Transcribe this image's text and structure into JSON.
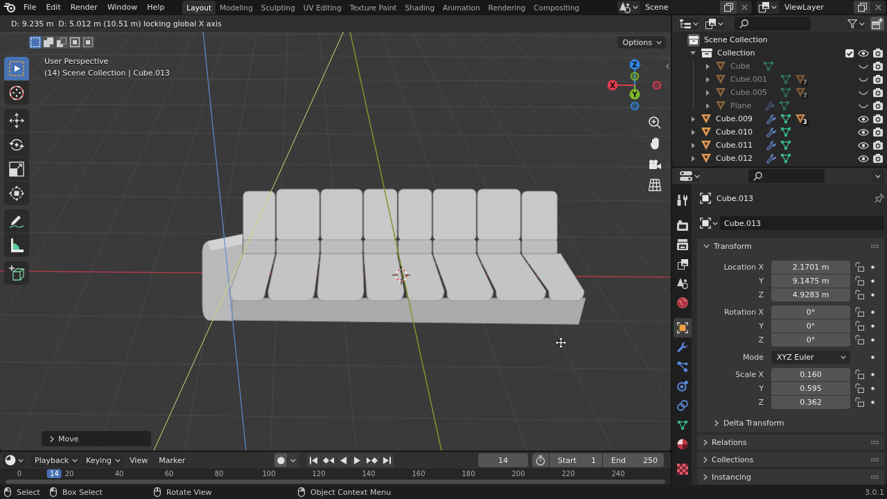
{
  "top_bar": {
    "menus": [
      "File",
      "Edit",
      "Render",
      "Window",
      "Help"
    ],
    "workspaces": [
      {
        "label": "Layout",
        "selected": true
      },
      {
        "label": "Modeling",
        "selected": false
      },
      {
        "label": "Sculpting",
        "selected": false
      },
      {
        "label": "UV Editing",
        "selected": false
      },
      {
        "label": "Texture Paint",
        "selected": false
      },
      {
        "label": "Shading",
        "selected": false
      },
      {
        "label": "Animation",
        "selected": false
      },
      {
        "label": "Rendering",
        "selected": false
      },
      {
        "label": "Compositing",
        "selected": false
      }
    ],
    "scene": "Scene",
    "view_layer": "ViewLayer"
  },
  "viewport": {
    "status_text": "D: 9.235 m  D: 5.012 m (10.51 m) locking global X axis",
    "select_modes": [
      {
        "kind": "set",
        "selected": true
      },
      {
        "kind": "extend",
        "selected": false
      },
      {
        "kind": "subtract",
        "selected": false
      },
      {
        "kind": "invert",
        "selected": false
      },
      {
        "kind": "intersect",
        "selected": false
      }
    ],
    "options": "Options",
    "tool_groups": [
      [
        {
          "kind": "select_box",
          "selected": true
        },
        {
          "kind": "cursor",
          "selected": false
        }
      ],
      [
        {
          "kind": "move",
          "selected": false
        },
        {
          "kind": "rotate",
          "selected": false
        },
        {
          "kind": "scale",
          "selected": false
        },
        {
          "kind": "transform",
          "selected": false
        }
      ],
      [
        {
          "kind": "annotate",
          "selected": false
        },
        {
          "kind": "measure",
          "selected": false
        }
      ],
      [
        {
          "kind": "add_cube",
          "selected": false
        }
      ]
    ],
    "view_name": "User Perspective",
    "context": "(14) Scene Collection | Cube.013",
    "gizmo_axes": [
      {
        "label": "Z",
        "color": "#2f86e0"
      },
      {
        "label": "X",
        "color": "#e23a50"
      },
      {
        "label": "Y",
        "color": "#7cb82a"
      }
    ],
    "navigation": [
      {
        "kind": "zoom"
      },
      {
        "kind": "pan"
      },
      {
        "kind": "camera"
      },
      {
        "kind": "ortho"
      }
    ],
    "redo_panel": {
      "title": "Move",
      "expanded": false
    }
  },
  "outliner": {
    "tree": [
      {
        "name": "Scene Collection",
        "kind": "scene_collection",
        "children": [
          {
            "name": "Collection",
            "kind": "collection",
            "expanded": true,
            "checked": true,
            "visible": true,
            "children": [
              {
                "name": "Cube",
                "kind": "object",
                "expanded": false,
                "visible": false,
                "data": [
                  {
                    "kind": "mesh"
                  }
                ]
              },
              {
                "name": "Cube.001",
                "kind": "object",
                "expanded": false,
                "visible": false,
                "data": [
                  {
                    "kind": "mesh"
                  },
                  {
                    "kind": "material",
                    "count": "7"
                  }
                ]
              },
              {
                "name": "Cube.005",
                "kind": "object",
                "expanded": false,
                "visible": false,
                "data": [
                  {
                    "kind": "mesh"
                  },
                  {
                    "kind": "material",
                    "count": "7"
                  }
                ]
              },
              {
                "name": "Plane",
                "kind": "object",
                "expanded": false,
                "visible": false,
                "data": [
                  {
                    "kind": "modifier"
                  },
                  {
                    "kind": "mesh"
                  }
                ]
              }
            ]
          },
          {
            "name": "Cube.009",
            "kind": "object",
            "expanded": false,
            "visible": true,
            "data": [
              {
                "kind": "modifier"
              },
              {
                "kind": "mesh"
              },
              {
                "kind": "material",
                "count": "3"
              }
            ]
          },
          {
            "name": "Cube.010",
            "kind": "object",
            "expanded": false,
            "visible": true,
            "data": [
              {
                "kind": "modifier"
              },
              {
                "kind": "mesh"
              }
            ]
          },
          {
            "name": "Cube.011",
            "kind": "object",
            "expanded": false,
            "visible": true,
            "data": [
              {
                "kind": "modifier"
              },
              {
                "kind": "mesh"
              }
            ]
          },
          {
            "name": "Cube.012",
            "kind": "object",
            "expanded": false,
            "visible": true,
            "data": [
              {
                "kind": "modifier"
              },
              {
                "kind": "mesh"
              }
            ]
          }
        ]
      }
    ]
  },
  "properties": {
    "tab_groups": [
      [
        {
          "kind": "tool",
          "selected": false
        }
      ],
      [
        {
          "kind": "render",
          "selected": false
        },
        {
          "kind": "output",
          "selected": false
        },
        {
          "kind": "view_layer",
          "selected": false
        },
        {
          "kind": "scene",
          "selected": false
        },
        {
          "kind": "world",
          "selected": false
        }
      ],
      [
        {
          "kind": "object",
          "selected": true
        },
        {
          "kind": "modifiers",
          "selected": false
        },
        {
          "kind": "particles",
          "selected": false
        },
        {
          "kind": "physics",
          "selected": false
        },
        {
          "kind": "constraints",
          "selected": false
        },
        {
          "kind": "data",
          "selected": false
        },
        {
          "kind": "material",
          "selected": false
        }
      ],
      [
        {
          "kind": "texture",
          "selected": false
        }
      ]
    ],
    "title": "Cube.013",
    "datablock": "Cube.013",
    "panels": [
      {
        "title": "Transform",
        "expanded": true,
        "groups": [
          [
            {
              "label": "Location X",
              "kind": "number",
              "value": "2.1701 m",
              "locked": false
            },
            {
              "label": "Y",
              "kind": "number",
              "value": "9.1475 m",
              "locked": false
            },
            {
              "label": "Z",
              "kind": "number",
              "value": "4.9283 m",
              "locked": false
            }
          ],
          [
            {
              "label": "Rotation X",
              "kind": "number",
              "value": "0°",
              "locked": false
            },
            {
              "label": "Y",
              "kind": "number",
              "value": "0°",
              "locked": false
            },
            {
              "label": "Z",
              "kind": "number",
              "value": "0°",
              "locked": false
            }
          ],
          [
            {
              "label": "Mode",
              "kind": "dropdown",
              "value": "XYZ Euler"
            }
          ],
          [
            {
              "label": "Scale X",
              "kind": "number",
              "value": "0.160",
              "locked": false
            },
            {
              "label": "Y",
              "kind": "number",
              "value": "0.595",
              "locked": false
            },
            {
              "label": "Z",
              "kind": "number",
              "value": "0.362",
              "locked": false
            }
          ]
        ],
        "subpanels": [
          {
            "title": "Delta Transform",
            "expanded": false
          }
        ]
      },
      {
        "title": "Relations",
        "expanded": false
      },
      {
        "title": "Collections",
        "expanded": false
      },
      {
        "title": "Instancing",
        "expanded": false
      }
    ]
  },
  "timeline": {
    "menus": [
      {
        "label": "Playback",
        "kind": "dropdown"
      },
      {
        "label": "Keying",
        "kind": "dropdown"
      },
      {
        "label": "View",
        "kind": "menu"
      },
      {
        "label": "Marker",
        "kind": "menu"
      }
    ],
    "auto_keying": false,
    "controls": [
      {
        "kind": "jump_start"
      },
      {
        "kind": "prev_keyframe"
      },
      {
        "kind": "play_reverse"
      },
      {
        "kind": "play"
      },
      {
        "kind": "next_keyframe"
      },
      {
        "kind": "jump_end"
      }
    ],
    "current_frame": "14",
    "start": {
      "label": "Start",
      "value": "1"
    },
    "end": {
      "label": "End",
      "value": "250"
    },
    "ruler": [
      "0",
      "20",
      "40",
      "60",
      "80",
      "100",
      "120",
      "140",
      "160",
      "180",
      "200",
      "220",
      "240"
    ],
    "playhead": "14"
  },
  "status_bar": {
    "hints": [
      {
        "kind": "left_click",
        "label": "Select"
      },
      {
        "kind": "left_drag",
        "label": "Box Select"
      },
      {
        "kind": "middle_drag",
        "label": "Rotate View"
      },
      {
        "kind": "right_click",
        "label": "Object Context Menu"
      }
    ],
    "version": "3.0.1"
  }
}
